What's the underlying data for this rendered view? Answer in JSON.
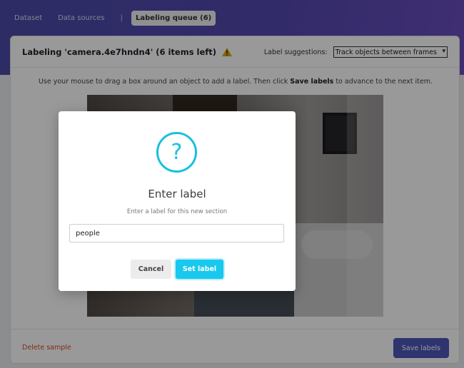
{
  "nav": {
    "dataset": "Dataset",
    "data_sources": "Data sources",
    "separator": "|",
    "labeling_queue": "Labeling queue (6)"
  },
  "card": {
    "title": "Labeling 'camera.4e7hndn4' (6 items left)",
    "warning_icon": "warning-triangle-icon",
    "suggestions_label": "Label suggestions:",
    "suggestions_selected": "Track objects between frames",
    "instructions_pre": "Use your mouse to drag a box around an object to add a label. Then click ",
    "instructions_bold": "Save labels",
    "instructions_post": " to advance to the next item.",
    "delete_label": "Delete sample",
    "save_label": "Save labels"
  },
  "modal": {
    "icon": "question-circle-icon",
    "title": "Enter label",
    "subtitle": "Enter a label for this new section",
    "input_value": "people",
    "cancel_label": "Cancel",
    "set_label": "Set label"
  },
  "colors": {
    "accent": "#18c8ee",
    "primary": "#4f56b8",
    "danger": "#d34a2f",
    "warning": "#e0a500"
  }
}
